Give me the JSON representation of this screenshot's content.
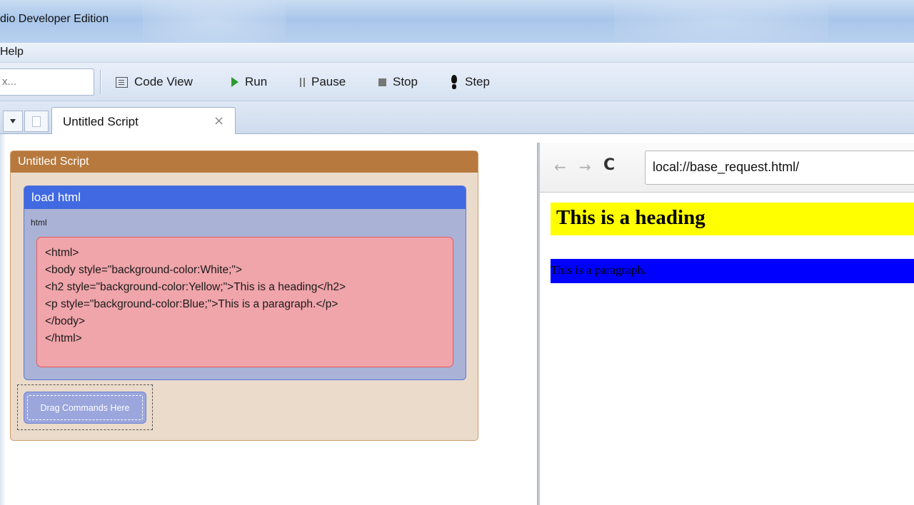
{
  "window": {
    "title": "dio Developer Edition"
  },
  "menu": {
    "help": "Help"
  },
  "toolbar": {
    "search_value": "x...",
    "code_view": "Code View",
    "run": "Run",
    "pause": "Pause",
    "stop": "Stop",
    "step": "Step"
  },
  "tabs": [
    {
      "label": "Untitled Script",
      "close": "×"
    }
  ],
  "script": {
    "title": "Untitled Script",
    "command": {
      "title": "load html",
      "param_label": "html",
      "code_lines": [
        "<html>",
        "<body style=\"background-color:White;\">",
        "<h2 style=\"background-color:Yellow;\">This is a heading</h2>",
        "<p style=\"background-color:Blue;\">This is a paragraph.</p>",
        "</body>",
        "</html>"
      ]
    },
    "drop_zone": "Drag Commands Here"
  },
  "browser": {
    "back": "←",
    "forward": "→",
    "reload": "C",
    "url": "local://base_request.html/",
    "heading": "This is a heading",
    "paragraph": "This is a paragraph.",
    "heading_bg": "#ffff00",
    "paragraph_bg": "#0000ff"
  },
  "colors": {
    "script_header": "#b7793d",
    "command_header": "#4169e1",
    "code_box": "#f0a5aa"
  }
}
